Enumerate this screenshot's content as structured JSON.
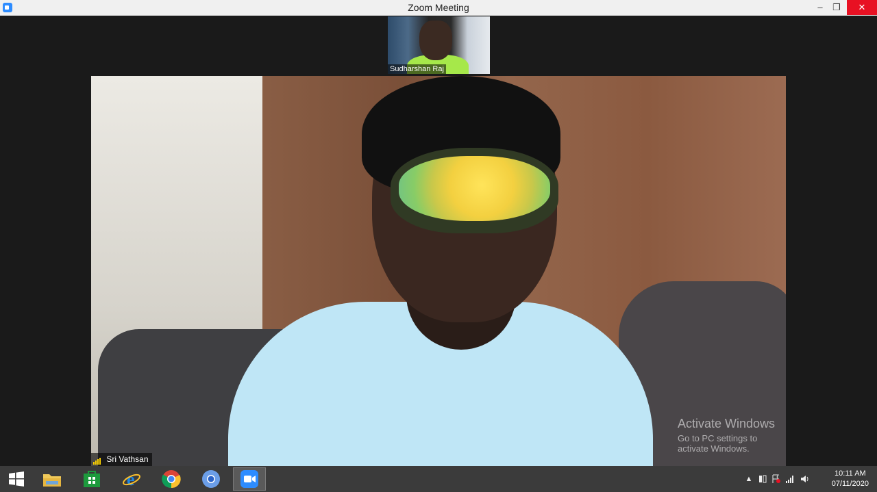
{
  "window": {
    "title": "Zoom Meeting",
    "minimize_glyph": "–",
    "maximize_glyph": "❐",
    "close_glyph": "✕"
  },
  "thumbnail": {
    "participant_name": "Sudharshan Raj"
  },
  "main_video": {
    "participant_name": "Sri Vathsan"
  },
  "watermark": {
    "title": "Activate Windows",
    "subtitle": "Go to PC settings to activate Windows."
  },
  "taskbar": {
    "pinned": [
      "start-icon",
      "file-explorer-icon",
      "store-icon",
      "internet-explorer-icon",
      "chrome-icon",
      "chromium-icon",
      "zoom-icon"
    ],
    "clock_time": "10:11 AM",
    "clock_date": "07/11/2020"
  },
  "colors": {
    "accent": "#2d8cff",
    "close": "#e81123"
  }
}
